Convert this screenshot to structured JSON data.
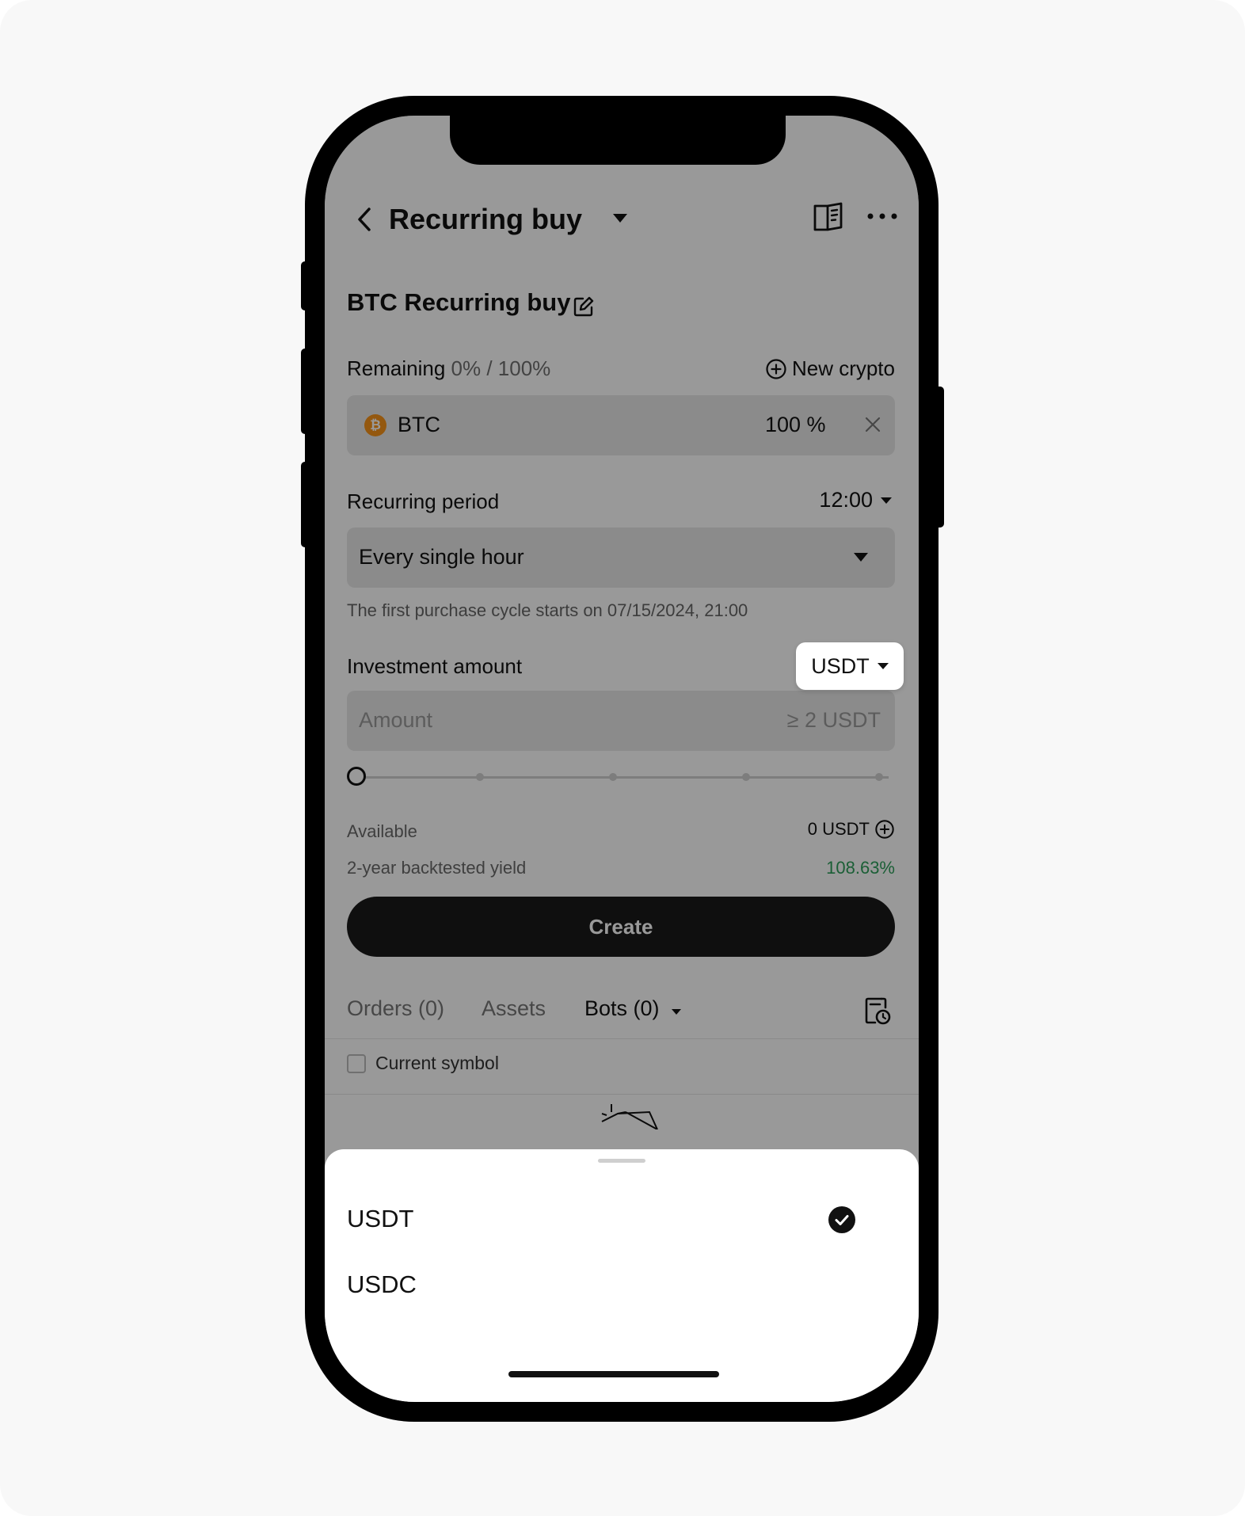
{
  "header": {
    "title": "Recurring buy"
  },
  "bot": {
    "name": "BTC Recurring buy"
  },
  "allocation": {
    "remaining_label": "Remaining",
    "remaining_value": "0% / 100%",
    "new_crypto_label": "New crypto",
    "coin": {
      "symbol": "BTC",
      "percent": "100 %",
      "logo_glyph": "₿"
    }
  },
  "period": {
    "label": "Recurring period",
    "time": "12:00",
    "value": "Every single hour",
    "first_cycle_note": "The first purchase cycle starts on 07/15/2024, 21:00"
  },
  "investment": {
    "label": "Investment amount",
    "currency": "USDT",
    "amount_placeholder": "Amount",
    "min_hint": "≥ 2 USDT",
    "slider_value": 0
  },
  "info": {
    "available_label": "Available",
    "available_value": "0 USDT",
    "yield_label": "2-year backtested yield",
    "yield_value": "108.63%",
    "yield_color": "#2e9e5b"
  },
  "create_label": "Create",
  "tabs": [
    {
      "label": "Orders (0)",
      "active": false
    },
    {
      "label": "Assets",
      "active": false
    },
    {
      "label": "Bots (0)",
      "active": true
    }
  ],
  "filter": {
    "current_symbol_label": "Current symbol",
    "checked": false
  },
  "sheet": {
    "options": [
      {
        "label": "USDT",
        "selected": true
      },
      {
        "label": "USDC",
        "selected": false
      }
    ]
  },
  "icons": [
    "back-icon",
    "book-icon",
    "more-icon",
    "edit-icon",
    "plus-circle-icon",
    "close-icon",
    "history-icon",
    "check-icon"
  ]
}
